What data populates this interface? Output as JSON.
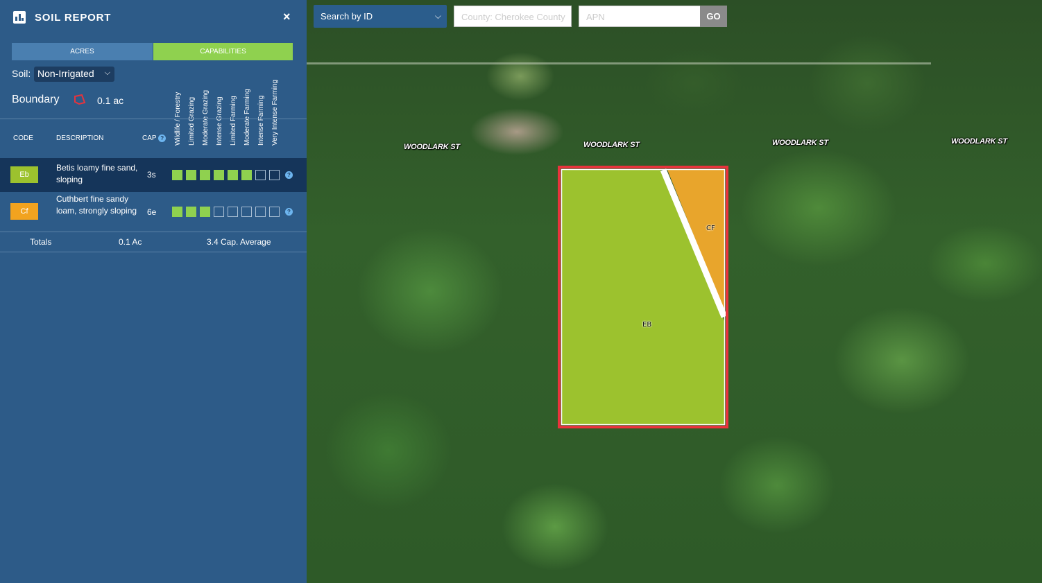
{
  "panel": {
    "title": "SOIL REPORT",
    "close_label": "×",
    "tabs": {
      "acres": "ACRES",
      "capabilities": "CAPABILITIES"
    },
    "soil_label": "Soil:",
    "soil_value": "Non-Irrigated",
    "boundary_label": "Boundary",
    "boundary_acres": "0.1 ac",
    "capability_headers": [
      "Wildlife / Forestry",
      "Limited Grazing",
      "Moderate Grazing",
      "Intense Grazing",
      "Limited Farming",
      "Moderate Farming",
      "Intense Farming",
      "Very Intense Farming"
    ],
    "columns": {
      "code": "CODE",
      "description": "DESCRIPTION",
      "cap": "CAP"
    },
    "help_glyph": "?",
    "rows": [
      {
        "code": "Eb",
        "description": "Betis loamy fine sand, sloping",
        "cap": "3s",
        "color": "#9cc22e",
        "filled": 6
      },
      {
        "code": "Cf",
        "description": "Cuthbert fine sandy loam, strongly sloping",
        "cap": "6e",
        "color": "#f2a31f",
        "filled": 3
      }
    ],
    "totals": {
      "label": "Totals",
      "acres": "0.1 Ac",
      "average": "3.4 Cap. Average"
    }
  },
  "search": {
    "mode": "Search by ID",
    "county_placeholder": "County: Cherokee County",
    "apn_placeholder": "APN",
    "go_label": "GO"
  },
  "map": {
    "street_labels": [
      "WOODLARK ST",
      "WOODLARK ST",
      "WOODLARK ST",
      "WOODLARK ST"
    ],
    "polygons": [
      {
        "label": "EB",
        "color": "#9cc22e"
      },
      {
        "label": "CF",
        "color": "#e8a52c"
      }
    ],
    "boundary_color": "#e8333c"
  }
}
